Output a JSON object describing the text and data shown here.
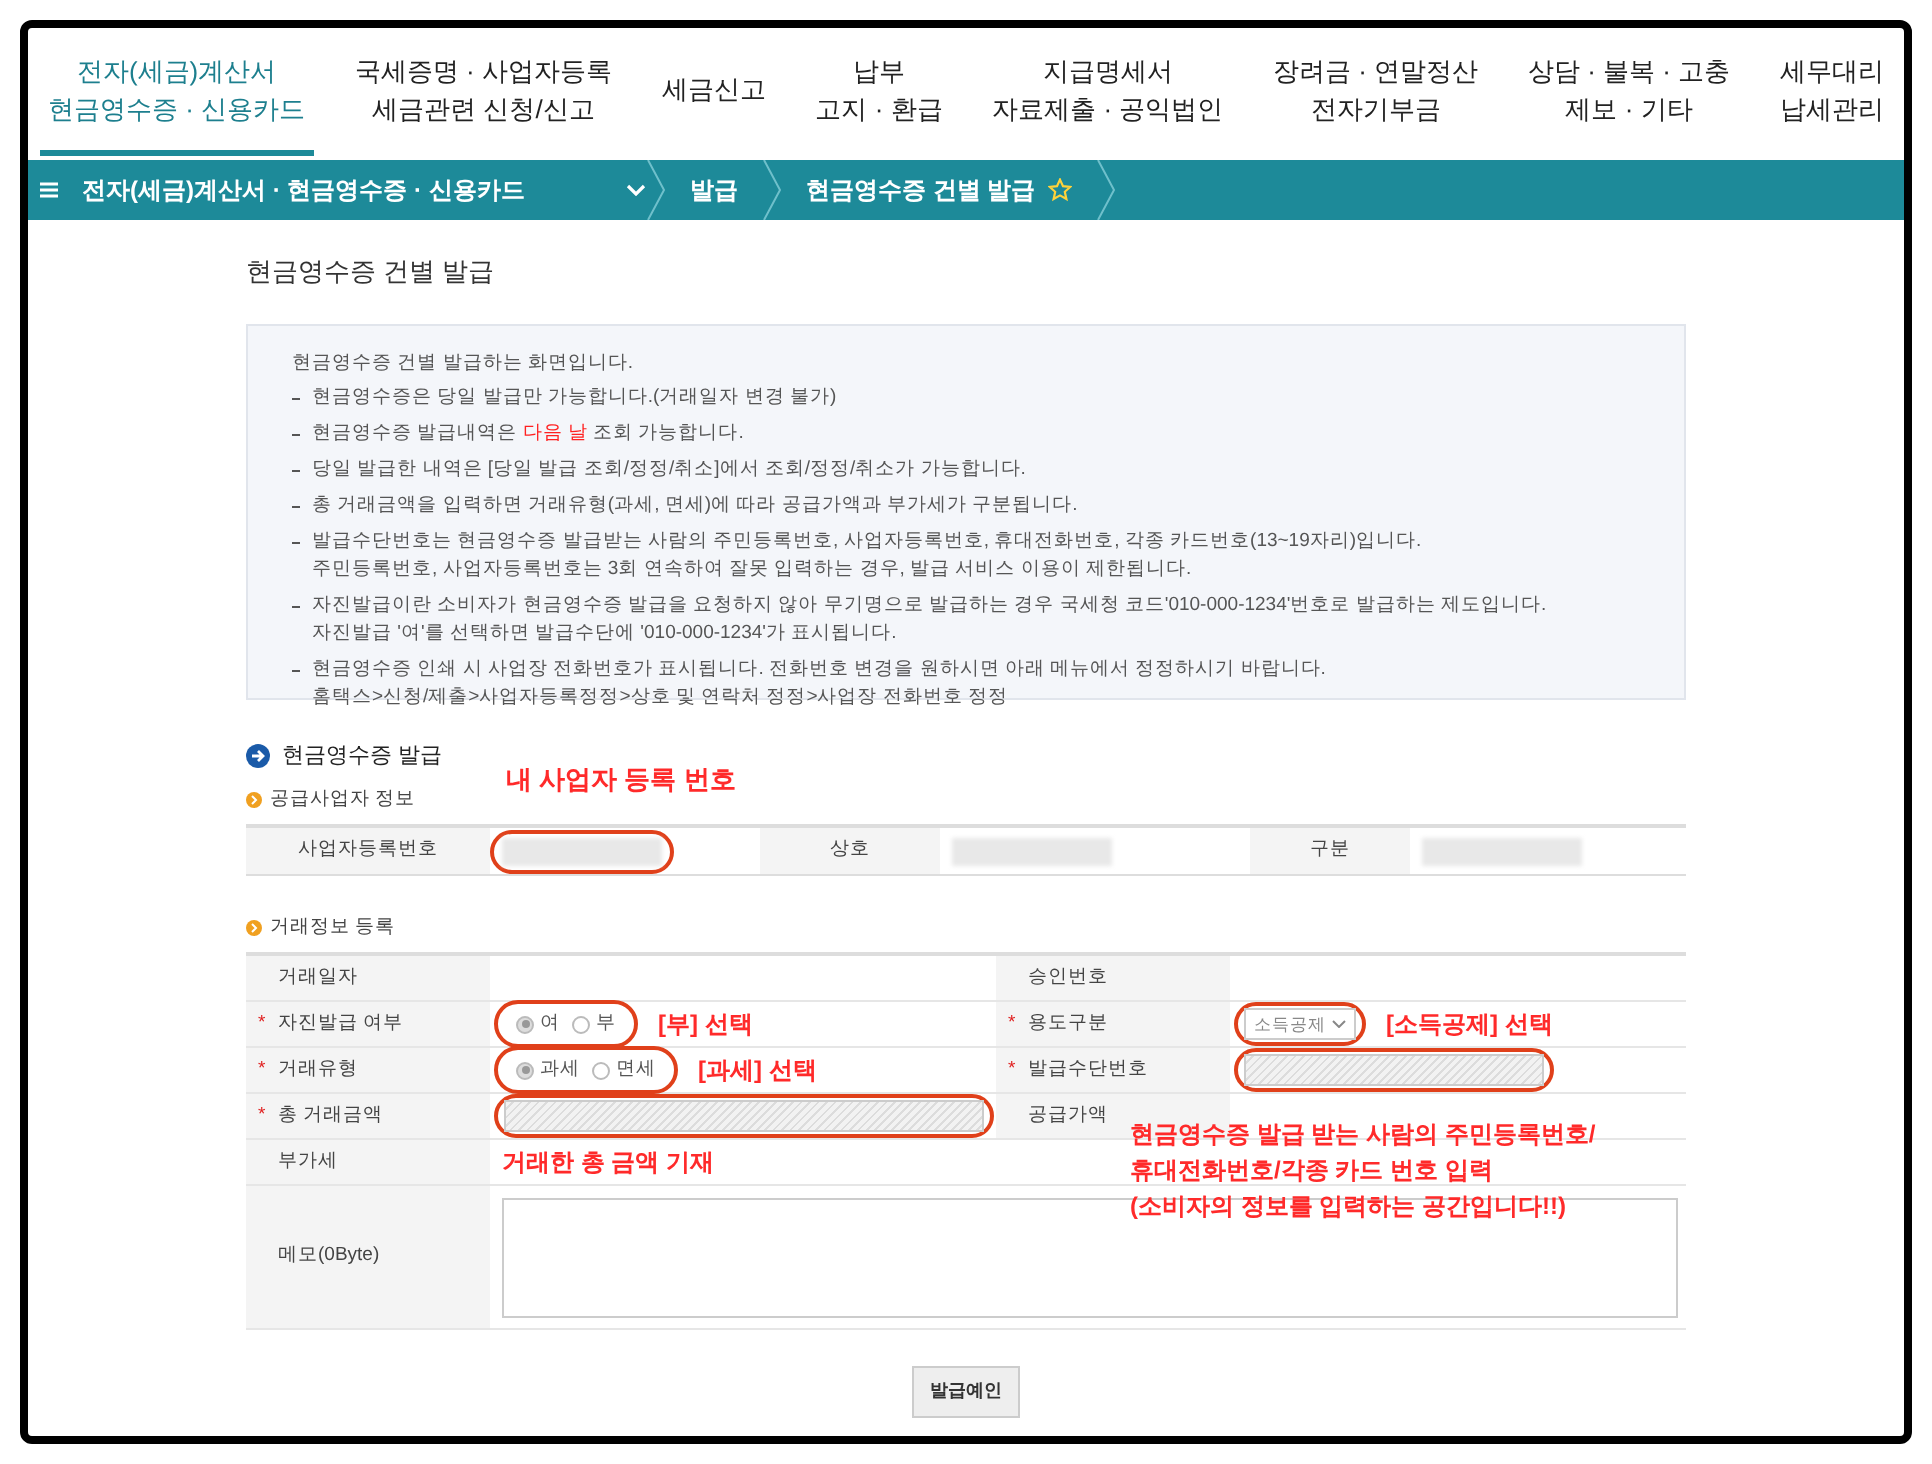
{
  "nav": [
    {
      "lines": [
        "전자(세금)계산서",
        "현금영수증 · 신용카드"
      ],
      "selected": true
    },
    {
      "lines": [
        "국세증명 · 사업자등록",
        "세금관련 신청/신고"
      ],
      "selected": false
    },
    {
      "lines": [
        "세금신고"
      ],
      "selected": false
    },
    {
      "lines": [
        "납부",
        "고지 · 환급"
      ],
      "selected": false
    },
    {
      "lines": [
        "지급명세서",
        "자료제출 · 공익법인"
      ],
      "selected": false
    },
    {
      "lines": [
        "장려금 · 연말정산",
        "전자기부금"
      ],
      "selected": false
    },
    {
      "lines": [
        "상담 · 불복 · 고충",
        "제보 · 기타"
      ],
      "selected": false
    },
    {
      "lines": [
        "세무대리",
        "납세관리"
      ],
      "selected": false
    }
  ],
  "breadcrumb": [
    {
      "label": "전자(세금)계산서 · 현금영수증 · 신용카드",
      "kind": "dropdown"
    },
    {
      "label": "발급",
      "kind": "plain"
    },
    {
      "label": "현금영수증 건별 발급",
      "kind": "favorite"
    }
  ],
  "page_title": "현금영수증 건별 발급",
  "notice": {
    "intro": "현금영수증 건별 발급하는 화면입니다.",
    "items": [
      {
        "lines": [
          [
            {
              "text": "현금영수증은 당일 발급만 가능합니다.(거래일자 변경 불가)",
              "emphasis": false
            }
          ]
        ]
      },
      {
        "lines": [
          [
            {
              "text": "현금영수증 발급내역은 ",
              "emphasis": false
            },
            {
              "text": "다음 날",
              "emphasis": true
            },
            {
              "text": " 조회 가능합니다.",
              "emphasis": false
            }
          ]
        ]
      },
      {
        "lines": [
          [
            {
              "text": "당일 발급한 내역은 [당일 발급 조회/정정/취소]에서 조회/정정/취소가 가능합니다.",
              "emphasis": false
            }
          ]
        ]
      },
      {
        "lines": [
          [
            {
              "text": "총 거래금액을 입력하면 거래유형(과세, 면세)에 따라 공급가액과 부가세가 구분됩니다.",
              "emphasis": false
            }
          ]
        ]
      },
      {
        "lines": [
          [
            {
              "text": "발급수단번호는 현금영수증 발급받는 사람의  주민등록번호, 사업자등록번호, 휴대전화번호, 각종 카드번호(13~19자리)입니다.",
              "emphasis": false
            }
          ],
          [
            {
              "text": "주민등록번호, 사업자등록번호는 3회 연속하여 잘못 입력하는 경우, 발급 서비스 이용이 제한됩니다.",
              "emphasis": false
            }
          ]
        ]
      },
      {
        "lines": [
          [
            {
              "text": "자진발급이란 소비자가 현금영수증 발급을 요청하지 않아 무기명으로 발급하는 경우 국세청 코드'010-000-1234'번호로 발급하는 제도입니다.",
              "emphasis": false
            }
          ],
          [
            {
              "text": "자진발급 '여'를 선택하면 발급수단에 '010-000-1234'가 표시됩니다.",
              "emphasis": false
            }
          ]
        ]
      },
      {
        "lines": [
          [
            {
              "text": "현금영수증 인쇄 시 사업장 전화번호가 표시됩니다. 전화번호 변경을 원하시면 아래 메뉴에서 정정하시기 바랍니다.",
              "emphasis": false
            }
          ],
          [
            {
              "text": "홈택스>신청/제출>사업자등록정정>상호 및 연락처 정정>사업장 전화번호 정정",
              "emphasis": false
            }
          ]
        ]
      }
    ]
  },
  "section_title": "현금영수증 발급",
  "supplier": {
    "heading": "공급사업자 정보",
    "annotation": "내 사업자 등록 번호",
    "fields": [
      {
        "label": "사업자등록번호",
        "highlighted": true
      },
      {
        "label": "상호",
        "highlighted": false
      },
      {
        "label": "구분",
        "highlighted": false
      }
    ]
  },
  "transaction": {
    "heading": "거래정보 등록",
    "rows": [
      [
        {
          "label": "거래일자",
          "kind": "empty"
        },
        {
          "label": "승인번호",
          "kind": "empty"
        }
      ],
      [
        {
          "label": "자진발급 여부",
          "marker": "*",
          "kind": "radio",
          "highlighted": true,
          "annotation": "[부] 선택",
          "options": [
            {
              "label": "여",
              "selected": true
            },
            {
              "label": "부",
              "selected": false
            }
          ]
        },
        {
          "label": "용도구분",
          "marker": "*",
          "kind": "select",
          "highlighted": true,
          "annotation": "[소득공제] 선택",
          "value": "소득공제"
        }
      ],
      [
        {
          "label": "거래유형",
          "marker": "*",
          "kind": "radio",
          "highlighted": true,
          "annotation": "[과세] 선택",
          "options": [
            {
              "label": "과세",
              "selected": true
            },
            {
              "label": "면세",
              "selected": false
            }
          ]
        },
        {
          "label": "발급수단번호",
          "marker": "*",
          "kind": "input",
          "highlighted": true
        }
      ],
      [
        {
          "label": "총 거래금액",
          "marker": "*",
          "kind": "input",
          "highlighted": true
        },
        {
          "label": "공급가액",
          "kind": "empty"
        }
      ],
      [
        {
          "label": "부가세",
          "kind": "empty",
          "annotation": "거래한 총 금액 기재"
        },
        {
          "kind": "note",
          "lines": [
            "현금영수증 발급 받는 사람의 주민등록번호/",
            "휴대전화번호/각종 카드 번호 입력",
            "(소비자의 정보를 입력하는 공간입니다!!)"
          ]
        }
      ]
    ],
    "memo_label": "메모(0Byte)"
  },
  "submit_button": "발급예인"
}
